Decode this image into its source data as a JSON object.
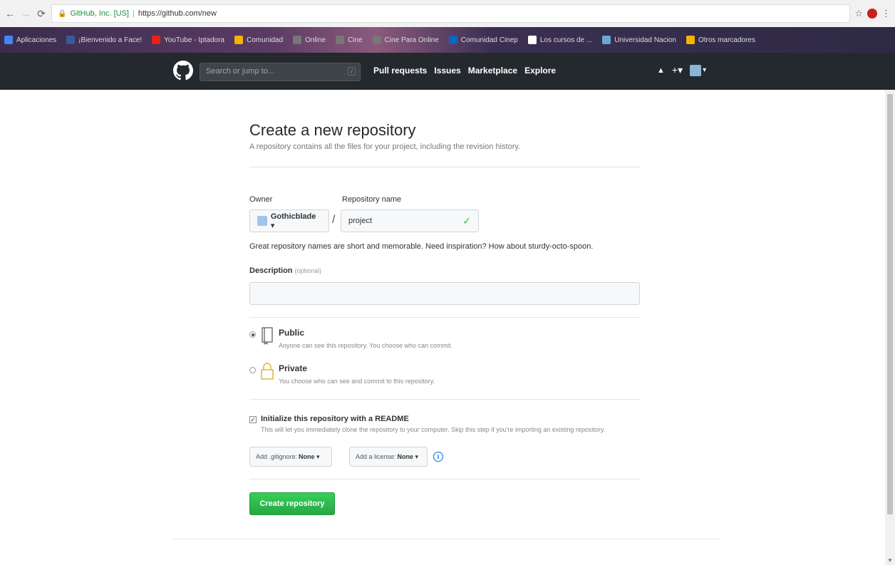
{
  "browser": {
    "secure_label": "GitHub, Inc. [US]",
    "url": "https://github.com/new",
    "bookmarks": [
      {
        "label": "Aplicaciones",
        "icon": "apps-icon",
        "color": "#4285f4"
      },
      {
        "label": "¡Bienvenido a Face!",
        "icon": "facebook-icon",
        "color": "#3b5998"
      },
      {
        "label": "YouTube - Iptadora",
        "icon": "youtube-icon",
        "color": "#e62117"
      },
      {
        "label": "Comunidad",
        "icon": "bookmark-icon",
        "color": "#f4b400"
      },
      {
        "label": "Online",
        "icon": "bookmark-icon",
        "color": "#777777"
      },
      {
        "label": "Cine",
        "icon": "bookmark-icon",
        "color": "#777777"
      },
      {
        "label": "Cine Para Online",
        "icon": "bookmark-icon",
        "color": "#777777"
      },
      {
        "label": "Comunidad Cinep",
        "icon": "bookmark-icon",
        "color": "#0a66c2"
      },
      {
        "label": "Los cursos de ...",
        "icon": "w-icon",
        "color": "#ffffff"
      },
      {
        "label": "Universidad Nacion",
        "icon": "bookmark-icon",
        "color": "#6aa7d8"
      },
      {
        "label": "Otros marcadores",
        "icon": "folder-icon",
        "color": "#f4b400"
      }
    ]
  },
  "header": {
    "search_placeholder": "Search or jump to...",
    "search_key": "/",
    "nav": [
      "Pull requests",
      "Issues",
      "Marketplace",
      "Explore"
    ],
    "bell": "🔔",
    "plus": "+▾",
    "caret": "▾"
  },
  "page": {
    "title": "Create a new repository",
    "subtitle": "A repository contains all the files for your project, including the revision history.",
    "owner_label": "Owner",
    "repo_label": "Repository name",
    "owner_value": "Gothicblade ▾",
    "slash": "/",
    "repo_value": "project",
    "check": "✓",
    "hint": "Great repository names are short and memorable. Need inspiration? How about sturdy-octo-spoon.",
    "description_label": "Description",
    "description_optional": "(optional)",
    "public_title": "Public",
    "public_desc": "Anyone can see this repository. You choose who can commit.",
    "private_title": "Private",
    "private_desc": "You choose who can see and commit to this repository.",
    "init_title": "Initialize this repository with a README",
    "init_desc": "This will let you immediately clone the repository to your computer. Skip this step if you're importing an existing repository.",
    "gitignore_prefix": "Add .gitignore:",
    "gitignore_value": "None ▾",
    "license_prefix": "Add a license:",
    "license_value": "None ▾",
    "info": "i",
    "create_button": "Create repository"
  }
}
